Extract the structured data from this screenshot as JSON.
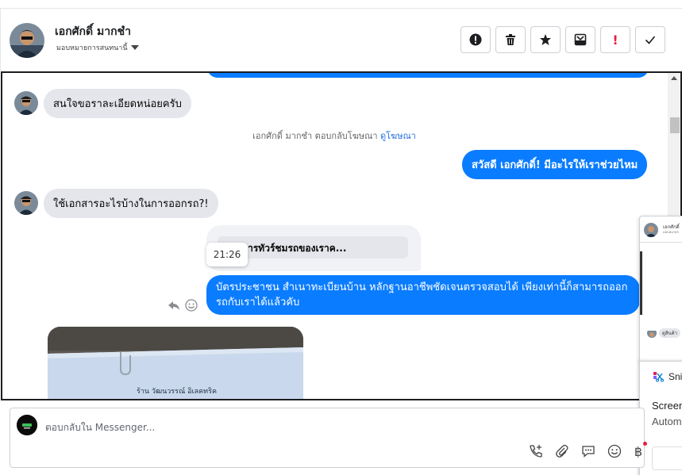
{
  "header": {
    "name": "เอกศักดิ์ มากชำ",
    "assign_label": "มอบหมายการสนทนานี้"
  },
  "toolbar": {
    "icons": [
      "alert-circle-icon",
      "trash-icon",
      "star-icon",
      "archive-icon",
      "exclamation-icon",
      "check-icon"
    ],
    "exclamation_text": "!"
  },
  "messages": {
    "in1": "สนใจขอราละเอียดหน่อยครับ",
    "system_prefix": "เอกศักดิ์ มากชำ ตอบกลับโฆษณา",
    "system_link": "ดูโฆษณา",
    "out1": "สวัสดี เอกศักดิ์! มีอะไรให้เราช่วยไหม",
    "in2": "ใช้เอกสารอะไรบ้างในการออกรถ?!",
    "quoted": "ต้องการทัวร์ชมรถของเราค...",
    "time": "21:26",
    "out2": "บัตรประชาชน สำเนาทะเบียนบ้าน หลักฐานอาชีพชัดเจนตรวจสอบได้ เพียงเท่านี้ก็สามารถออกรถกับเราได้แล้วคับ",
    "photo_caption": "ร้าน วัฒนวรรณ์ อิเลคทริค"
  },
  "overlay": {
    "name_small": "เอกศักดิ์",
    "sub_small": "มอบหมายก",
    "tag": "ดูสินค้า",
    "snip_title": "Sni",
    "snip_line1": "Screen",
    "snip_line2": "Autom"
  },
  "composer": {
    "placeholder": "ตอบกลับใน Messenger...",
    "icons": [
      "phone-plus-icon",
      "paperclip-icon",
      "chat-bubble-icon",
      "emoji-icon",
      "baht-icon"
    ],
    "baht_symbol": "฿"
  },
  "colors": {
    "accent": "#0a7cff",
    "incoming": "#e4e6eb",
    "link": "#216fdb"
  }
}
